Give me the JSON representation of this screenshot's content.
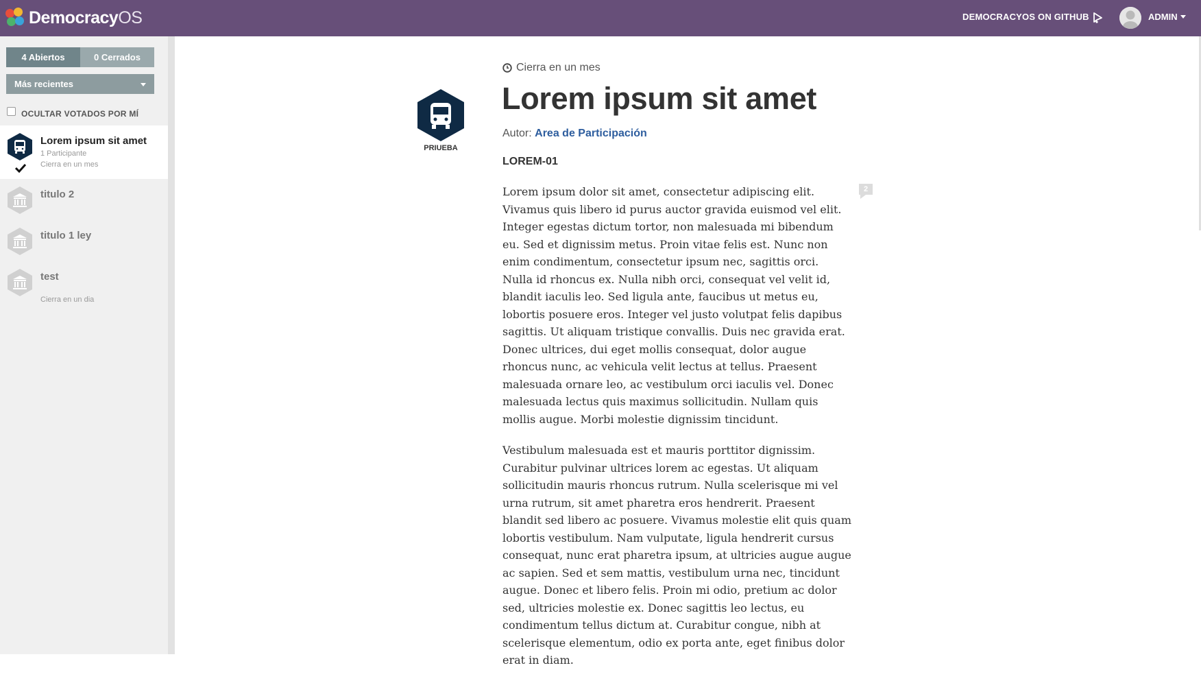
{
  "header": {
    "logo_bold": "Democracy",
    "logo_light": "OS",
    "github_label": "DEMOCRACYOS ON GITHUB",
    "user_label": "ADMIN",
    "colors": {
      "bar": "#674f79"
    }
  },
  "sidebar": {
    "tab_open": "4 Abiertos",
    "tab_closed": "0 Cerrados",
    "sort_label": "Más recientes",
    "hide_voted_label": "OCULTAR VOTADOS POR MÍ",
    "topics": [
      {
        "title": "Lorem ipsum sit amet",
        "participants": "1 Participante",
        "closes": "Cierra en un mes",
        "icon": "bus-icon",
        "voted": true
      },
      {
        "title": "titulo 2",
        "icon": "institution-icon"
      },
      {
        "title": "titulo 1 ley",
        "icon": "institution-icon"
      },
      {
        "title": "test",
        "closes": "Cierra en un dia",
        "icon": "institution-icon"
      }
    ]
  },
  "main": {
    "closes": "Cierra en un mes",
    "title": "Lorem ipsum sit amet",
    "author_prefix": "Autor:",
    "author_name": "Area de Participación",
    "code": "LOREM-01",
    "tag_label": "PRIUEBA",
    "comment_count": "2",
    "paragraphs": [
      "Lorem ipsum dolor sit amet, consectetur adipiscing elit. Vivamus quis libero id purus auctor gravida euismod vel elit. Integer egestas dictum tortor, non malesuada mi bibendum eu. Sed et dignissim metus. Proin vitae felis est. Nunc non enim condimentum, consectetur ipsum nec, sagittis orci. Nulla id rhoncus ex. Nulla nibh orci, consequat vel velit id, blandit iaculis leo. Sed ligula ante, faucibus ut metus eu, lobortis posuere eros. Integer vel justo volutpat felis dapibus sagittis. Ut aliquam tristique convallis. Duis nec gravida erat. Donec ultrices, dui eget mollis consequat, dolor augue rhoncus nunc, ac vehicula velit lectus at tellus. Praesent malesuada ornare leo, ac vestibulum orci iaculis vel. Donec malesuada lectus quis maximus sollicitudin. Nullam quis mollis augue. Morbi molestie dignissim tincidunt.",
      "Vestibulum malesuada est et mauris porttitor dignissim. Curabitur pulvinar ultrices lorem ac egestas. Ut aliquam sollicitudin mauris rhoncus rutrum. Nulla scelerisque mi vel urna rutrum, sit amet pharetra eros hendrerit. Praesent blandit sed libero ac posuere. Vivamus molestie elit quis quam lobortis vestibulum. Nam vulputate, ligula hendrerit cursus consequat, nunc erat pharetra ipsum, at ultricies augue augue ac sapien. Sed et sem mattis, vestibulum urna nec, tincidunt augue. Donec et libero felis. Proin mi odio, pretium ac dolor sed, ultricies molestie ex. Donec sagittis leo lectus, eu condimentum tellus dictum at. Curabitur congue, nibh at scelerisque elementum, odio ex porta ante, eget finibus dolor erat in diam."
    ]
  }
}
